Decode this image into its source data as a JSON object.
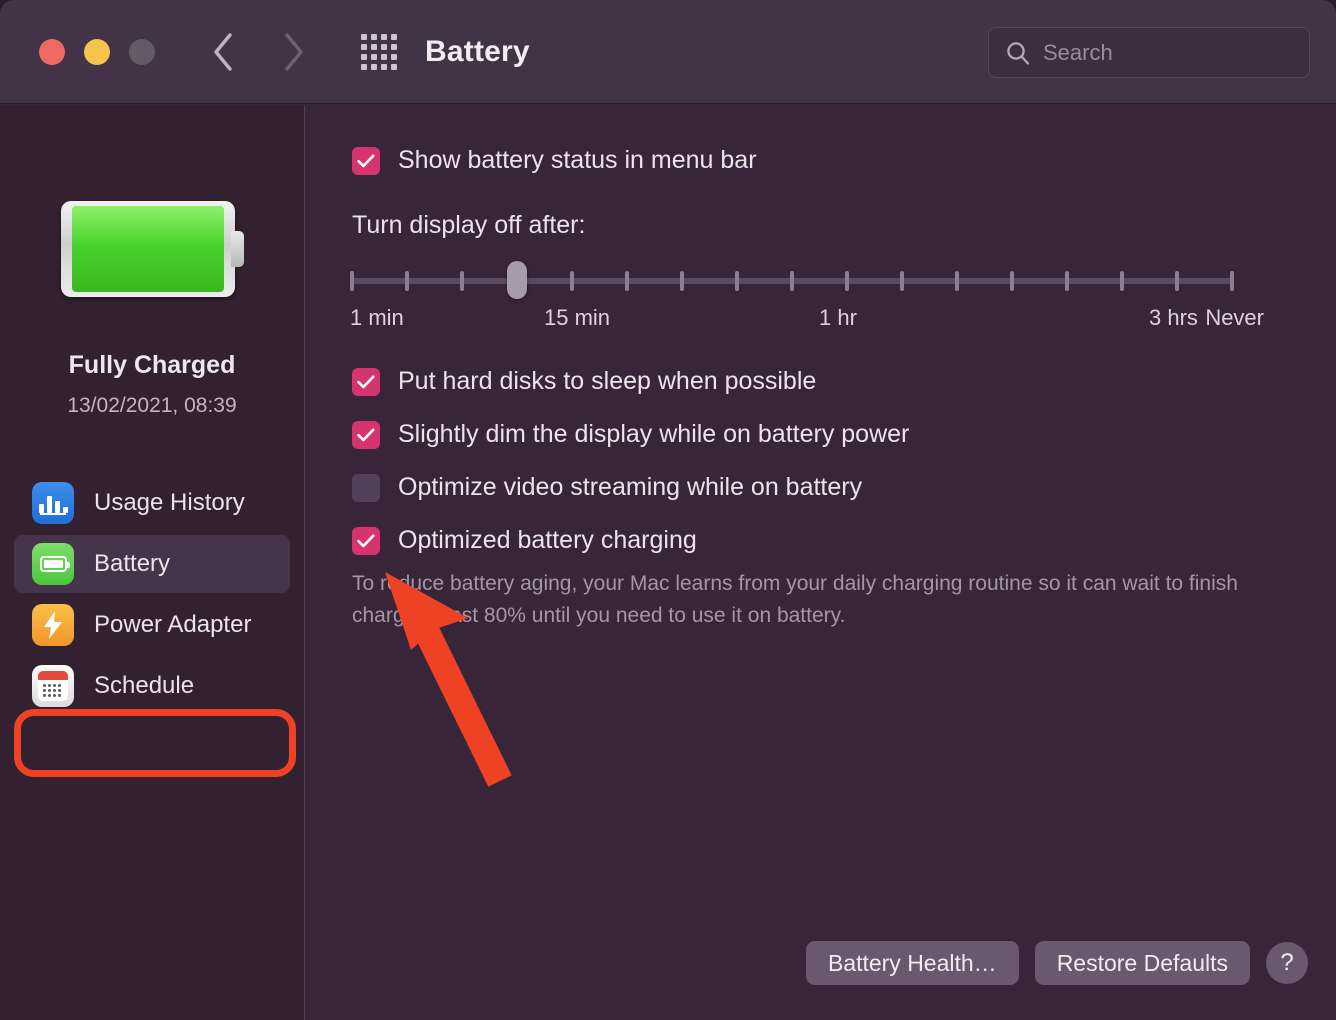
{
  "window": {
    "title": "Battery",
    "traffic_lights": [
      "close",
      "minimize",
      "maximize"
    ],
    "back_icon": "chevron-left-icon",
    "forward_icon": "chevron-right-icon",
    "grid_icon": "show-all-grid-icon"
  },
  "search": {
    "placeholder": "Search",
    "value": "",
    "icon": "search-icon"
  },
  "sidebar": {
    "battery_icon": "full-battery-illustration",
    "status_title": "Fully Charged",
    "status_subtitle": "13/02/2021, 08:39",
    "items": [
      {
        "label": "Usage History",
        "icon": "usage-history-icon",
        "selected": false
      },
      {
        "label": "Battery",
        "icon": "battery-icon",
        "selected": true
      },
      {
        "label": "Power Adapter",
        "icon": "power-adapter-icon",
        "selected": false
      },
      {
        "label": "Schedule",
        "icon": "schedule-calendar-icon",
        "selected": false
      }
    ]
  },
  "main": {
    "menubar_checkbox": {
      "label": "Show battery status in menu bar",
      "checked": true
    },
    "display_off": {
      "label": "Turn display off after:",
      "tick_count": 17,
      "thumb_index": 3,
      "tick_labels": [
        {
          "text": "1 min",
          "index": 0
        },
        {
          "text": "15 min",
          "index": 4
        },
        {
          "text": "1 hr",
          "index": 9
        },
        {
          "text": "3 hrs",
          "index": 15
        },
        {
          "text": "Never",
          "index": 16
        }
      ]
    },
    "options": [
      {
        "label": "Put hard disks to sleep when possible",
        "checked": true
      },
      {
        "label": "Slightly dim the display while on battery power",
        "checked": true
      },
      {
        "label": "Optimize video streaming while on battery",
        "checked": false
      },
      {
        "label": "Optimized battery charging",
        "checked": true
      }
    ],
    "description": "To reduce battery aging, your Mac learns from your daily charging routine so it can wait to finish charging past 80% until you need to use it on battery."
  },
  "footer": {
    "battery_health_label": "Battery Health…",
    "restore_defaults_label": "Restore Defaults",
    "help_label": "?"
  },
  "annotations": {
    "highlight_target": "Battery",
    "arrow_color": "#ef4123",
    "ring_color": "#ef4123"
  },
  "colors": {
    "accent_checkbox": "#d6346f",
    "window_bg": "#382539",
    "sidebar_bg": "#332131",
    "titlebar_bg": "#433346",
    "annotation_red": "#ef4123",
    "battery_green": "#46d12a"
  }
}
